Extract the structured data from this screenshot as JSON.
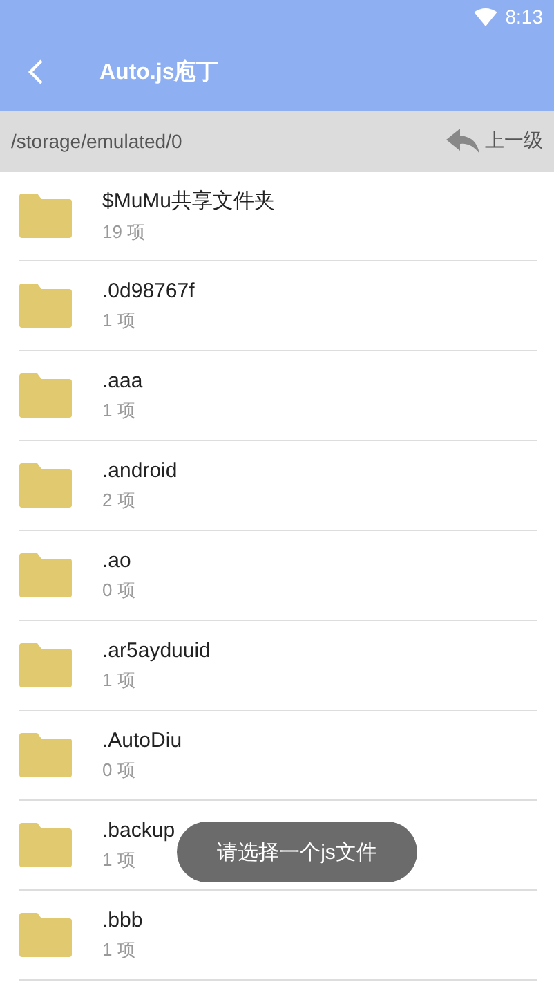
{
  "status_bar": {
    "time": "8:13"
  },
  "toolbar": {
    "title": "Auto.js庖丁"
  },
  "path_bar": {
    "path": "/storage/emulated/0",
    "up_label": "上一级"
  },
  "items": [
    {
      "name": "$MuMu共享文件夹",
      "count": "19 项"
    },
    {
      "name": ".0d98767f",
      "count": "1 项"
    },
    {
      "name": ".aaa",
      "count": "1 项"
    },
    {
      "name": ".android",
      "count": "2 项"
    },
    {
      "name": ".ao",
      "count": "0 项"
    },
    {
      "name": ".ar5ayduuid",
      "count": "1 项"
    },
    {
      "name": ".AutoDiu",
      "count": "0 项"
    },
    {
      "name": ".backup",
      "count": "1 项"
    },
    {
      "name": ".bbb",
      "count": "1 项"
    }
  ],
  "toast": {
    "text": "请选择一个js文件"
  }
}
